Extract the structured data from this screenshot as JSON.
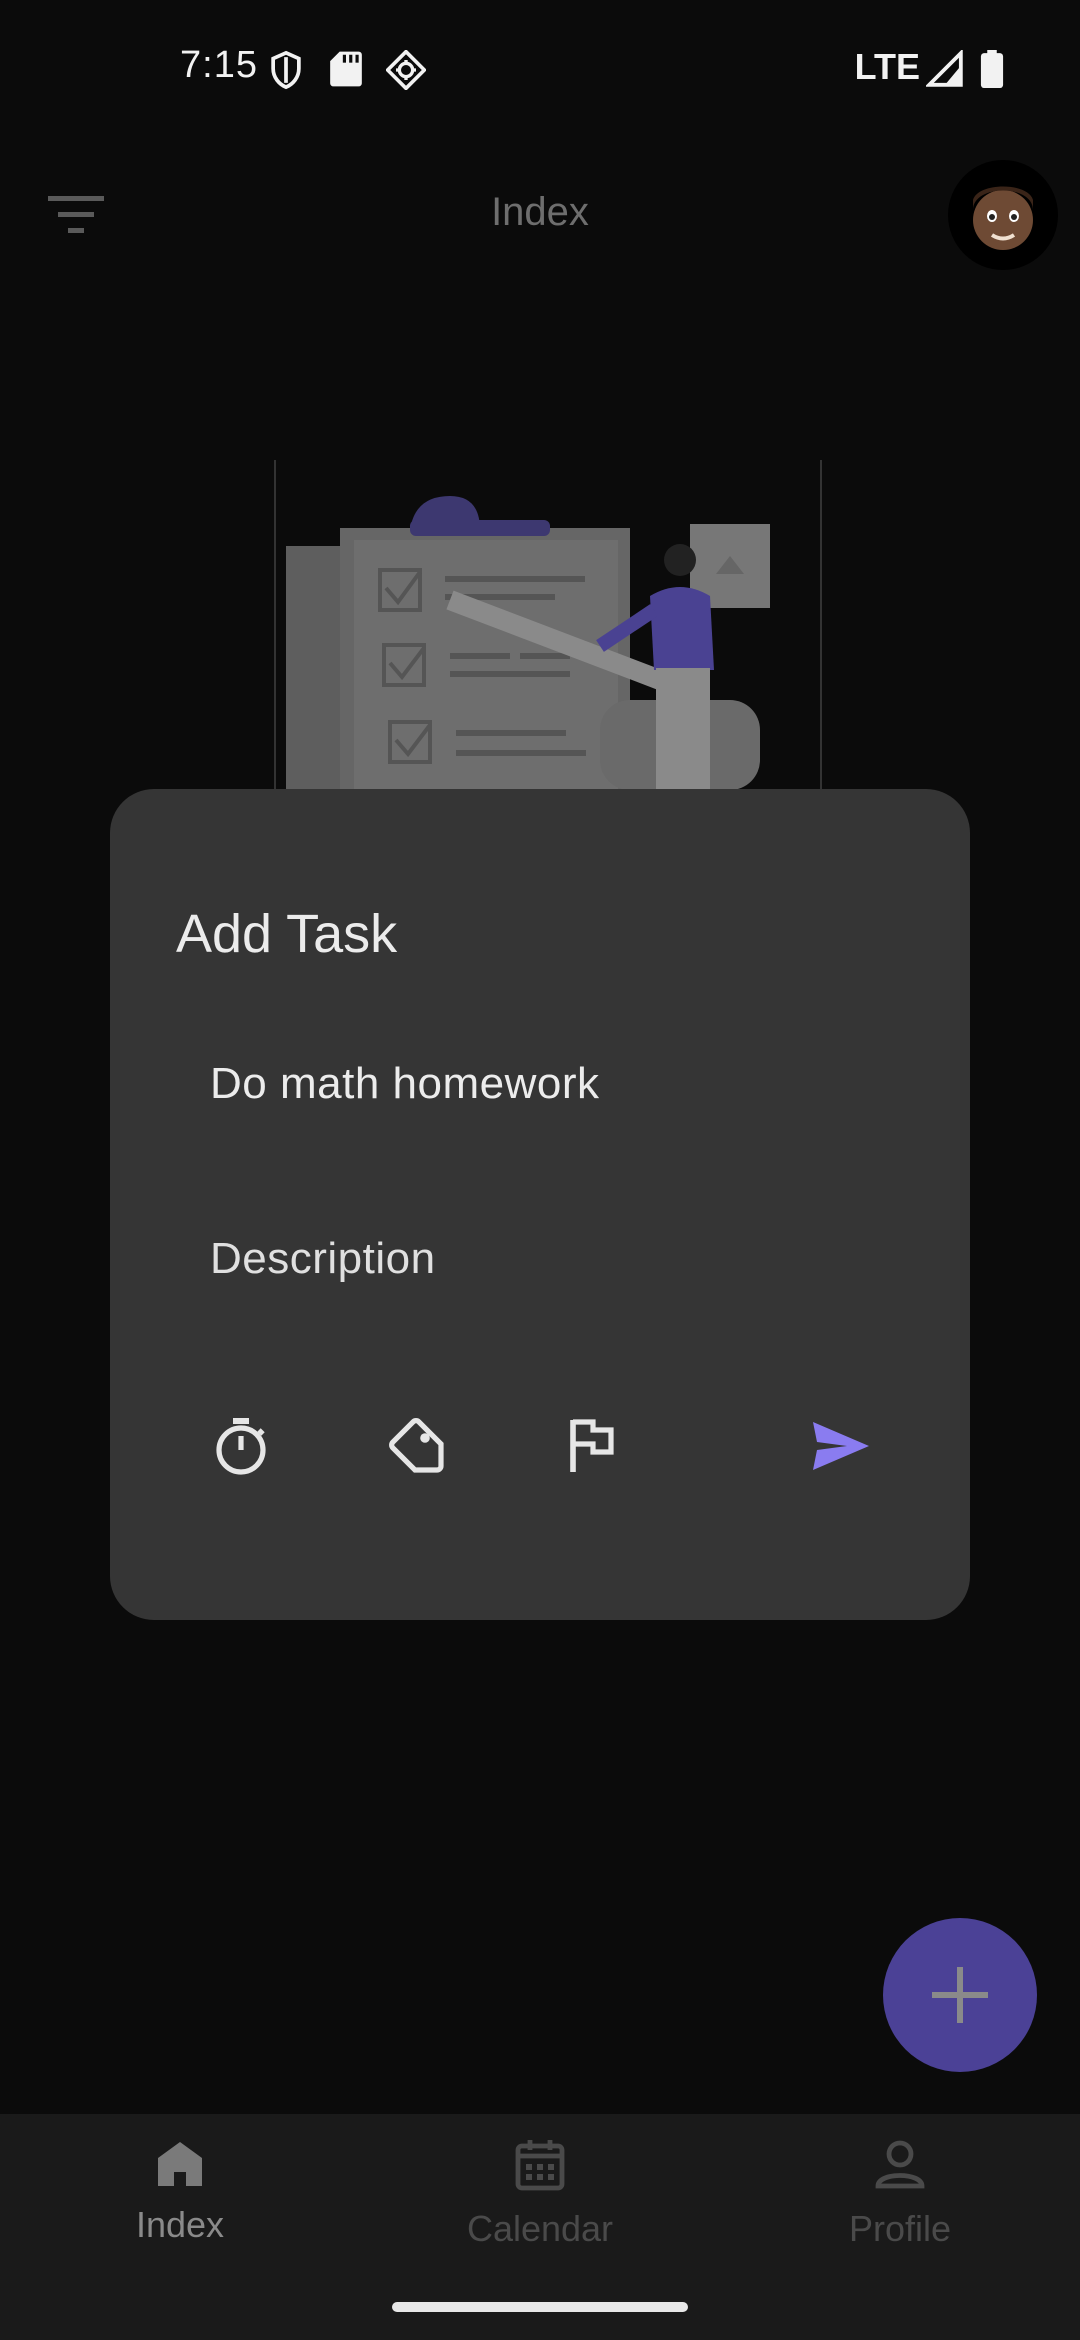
{
  "status_bar": {
    "time": "7:15",
    "network": "LTE"
  },
  "top_bar": {
    "title": "Index"
  },
  "dialog": {
    "title": "Add Task",
    "task_name": "Do math homework",
    "description_placeholder": "Description",
    "actions": [
      "timer-icon",
      "tag-icon",
      "flag-icon",
      "send-icon"
    ]
  },
  "bottom_nav": {
    "items": [
      {
        "label": "Index",
        "icon": "home-icon",
        "active": true
      },
      {
        "label": "Calendar",
        "icon": "calendar-icon",
        "active": false
      },
      {
        "label": "Profile",
        "icon": "profile-icon",
        "active": false
      }
    ]
  },
  "colors": {
    "accent": "#8a7cf0",
    "fab": "#4b4196",
    "dialog": "#353535",
    "background": "#0b0b0b"
  }
}
